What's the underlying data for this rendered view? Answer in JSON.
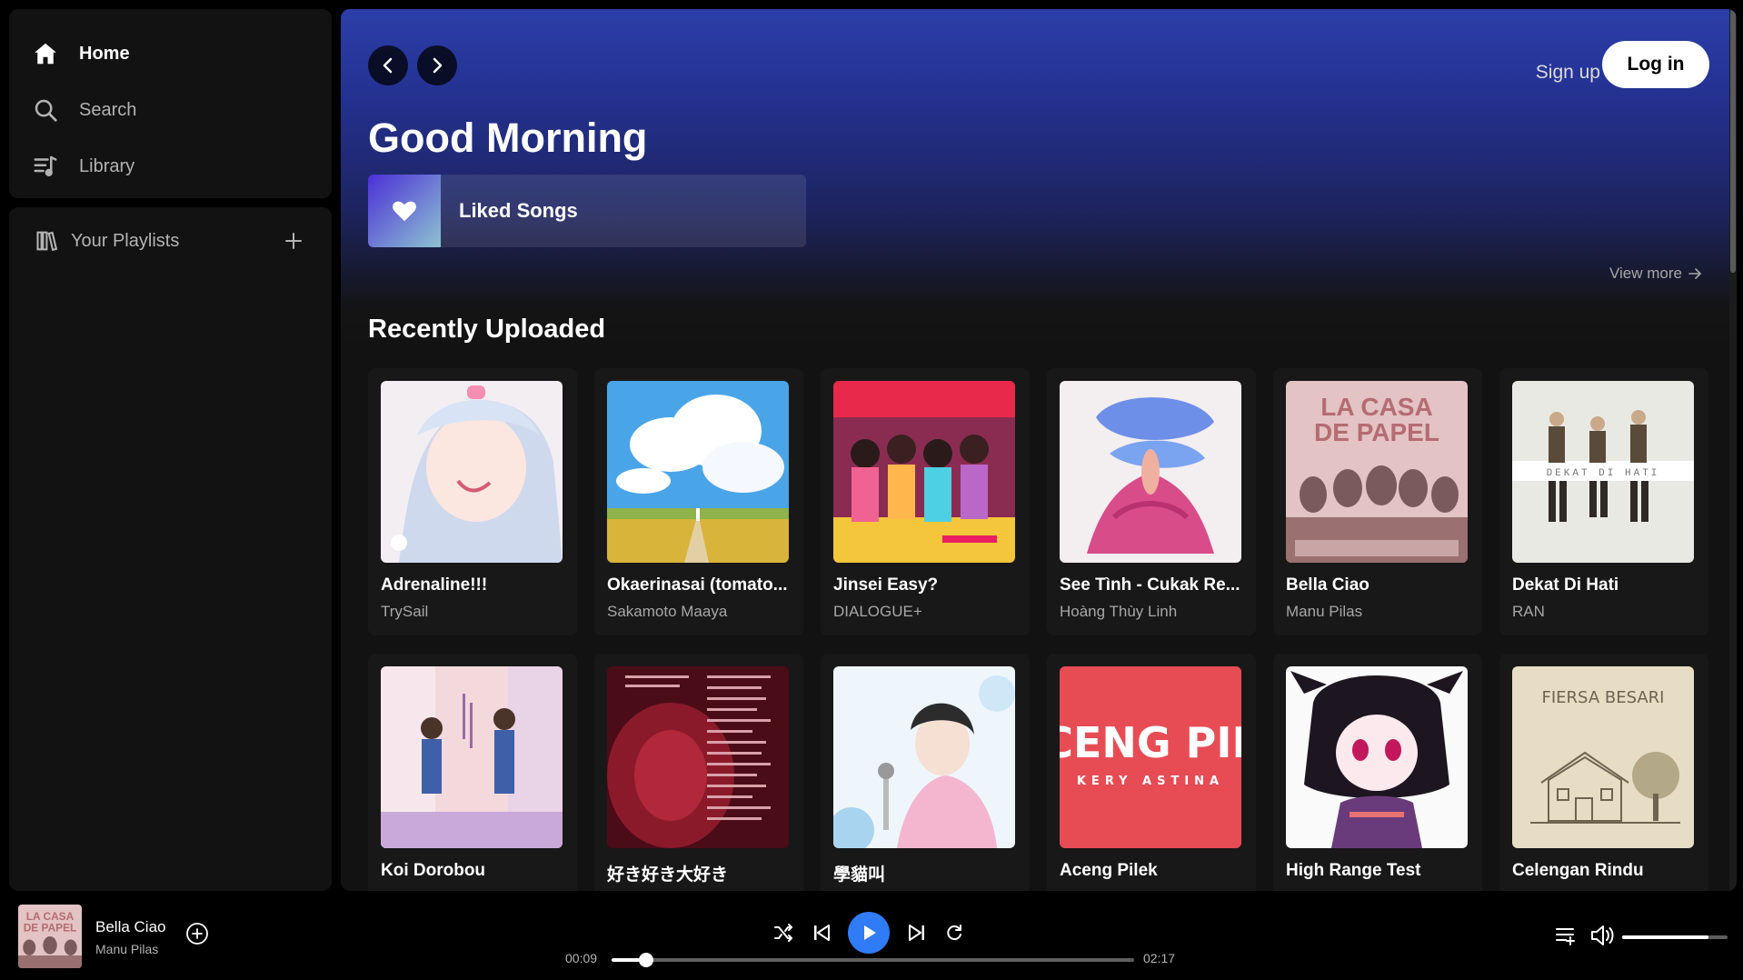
{
  "sidebar": {
    "nav": [
      {
        "label": "Home",
        "icon": "home-icon",
        "active": true
      },
      {
        "label": "Search",
        "icon": "search-icon",
        "active": false
      },
      {
        "label": "Library",
        "icon": "library-icon",
        "active": false
      }
    ],
    "playlists_label": "Your Playlists"
  },
  "header": {
    "signup_label": "Sign up",
    "login_label": "Log in",
    "greeting": "Good Morning"
  },
  "liked_songs": {
    "label": "Liked Songs"
  },
  "view_more_label": "View more",
  "section_title": "Recently Uploaded",
  "cards": [
    {
      "title": "Adrenaline!!!",
      "artist": "TrySail"
    },
    {
      "title": "Okaerinasai (tomato...",
      "artist": "Sakamoto Maaya"
    },
    {
      "title": "Jinsei Easy?",
      "artist": "DIALOGUE+"
    },
    {
      "title": "See Tình - Cukak Re...",
      "artist": "Hoàng Thùy Linh"
    },
    {
      "title": "Bella Ciao",
      "artist": "Manu Pilas"
    },
    {
      "title": "Dekat Di Hati",
      "artist": "RAN"
    },
    {
      "title": "Koi Dorobou",
      "artist": ""
    },
    {
      "title": "好き好き大好き",
      "artist": ""
    },
    {
      "title": "學貓叫",
      "artist": ""
    },
    {
      "title": "Aceng Pilek",
      "artist": ""
    },
    {
      "title": "High Range Test",
      "artist": ""
    },
    {
      "title": "Celengan Rindu",
      "artist": ""
    }
  ],
  "cover_text": {
    "la_casa": "LA CASA",
    "de_papel": "DE PAPEL",
    "dekat": "DEKAT DI HATI",
    "aceng": "CENG PIL",
    "kery": "KERY ASTINA",
    "fiersa": "FIERSA BESARI"
  },
  "player": {
    "title": "Bella Ciao",
    "artist": "Manu Pilas",
    "current_time": "00:09",
    "total_time": "02:17",
    "progress": 0.066,
    "volume": 0.82,
    "accent": "#2f7cf6"
  }
}
